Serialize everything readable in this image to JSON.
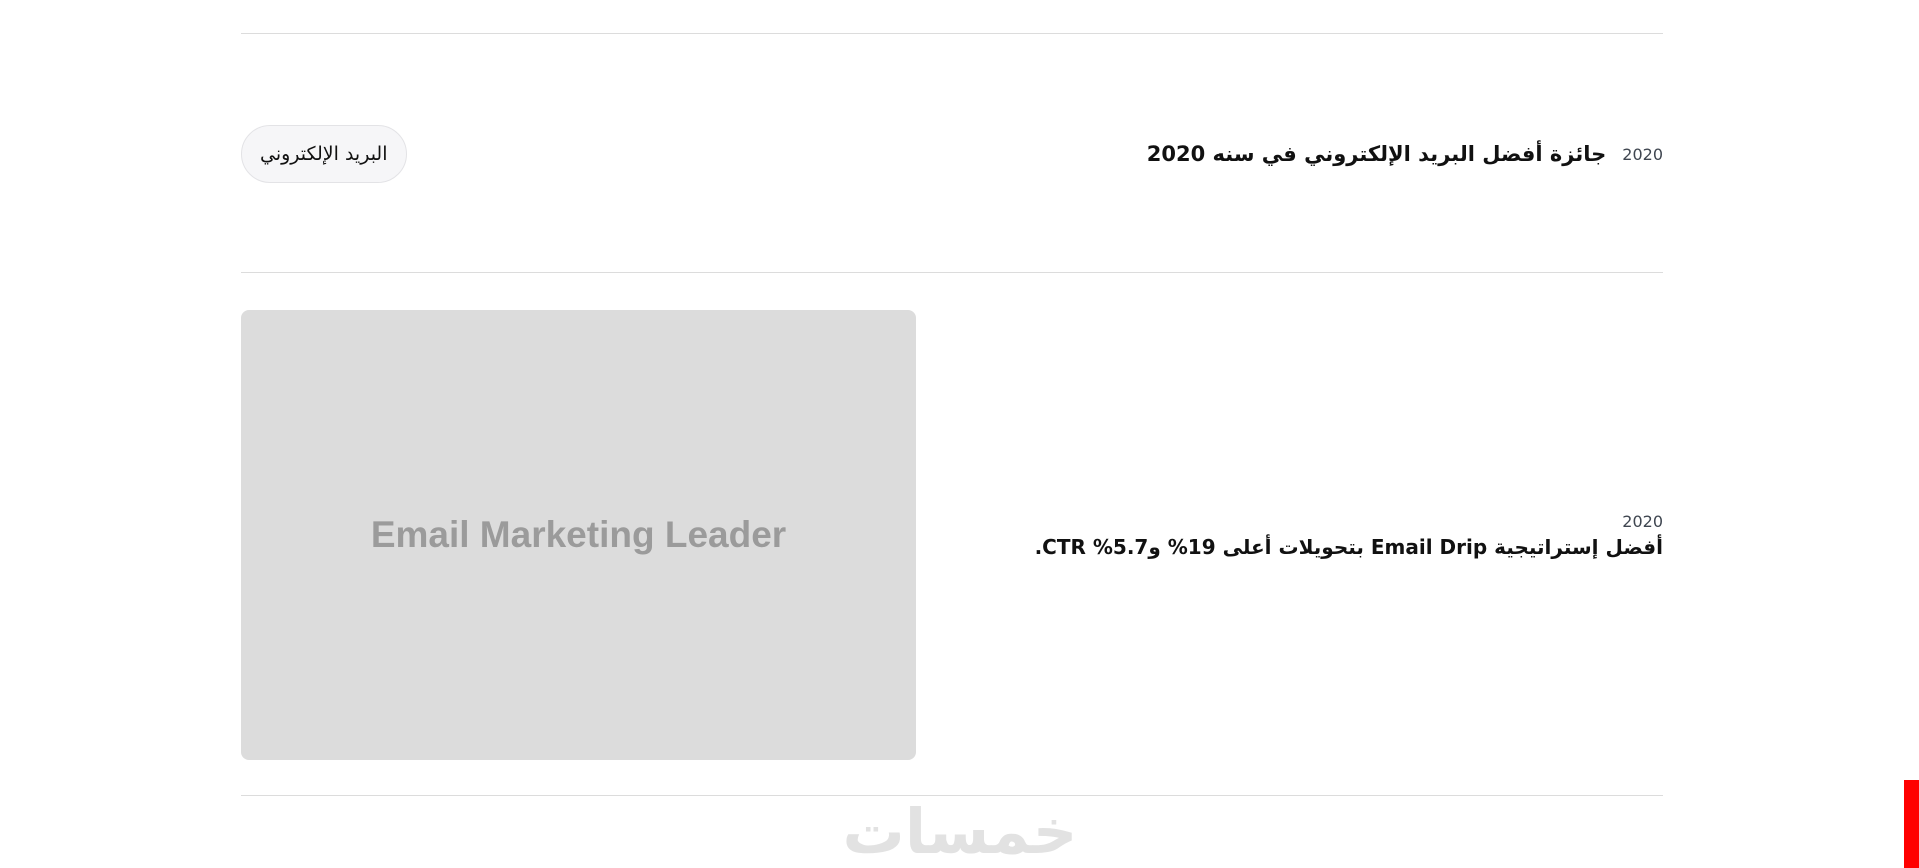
{
  "award": {
    "year": "2020",
    "title": "جائزة أفضل البريد الإلكتروني في سنه 2020",
    "tag": "البريد الإلكتروني"
  },
  "card": {
    "image_caption": "Email Marketing Leader",
    "year": "2020",
    "title": "أفضل إستراتيجية Email Drip بتحويلات أعلى 19% و5.7% CTR."
  },
  "watermark": "خمسات",
  "colors": {
    "accent_bar": "#ff0000",
    "image_placeholder": "#dcdcdc"
  }
}
